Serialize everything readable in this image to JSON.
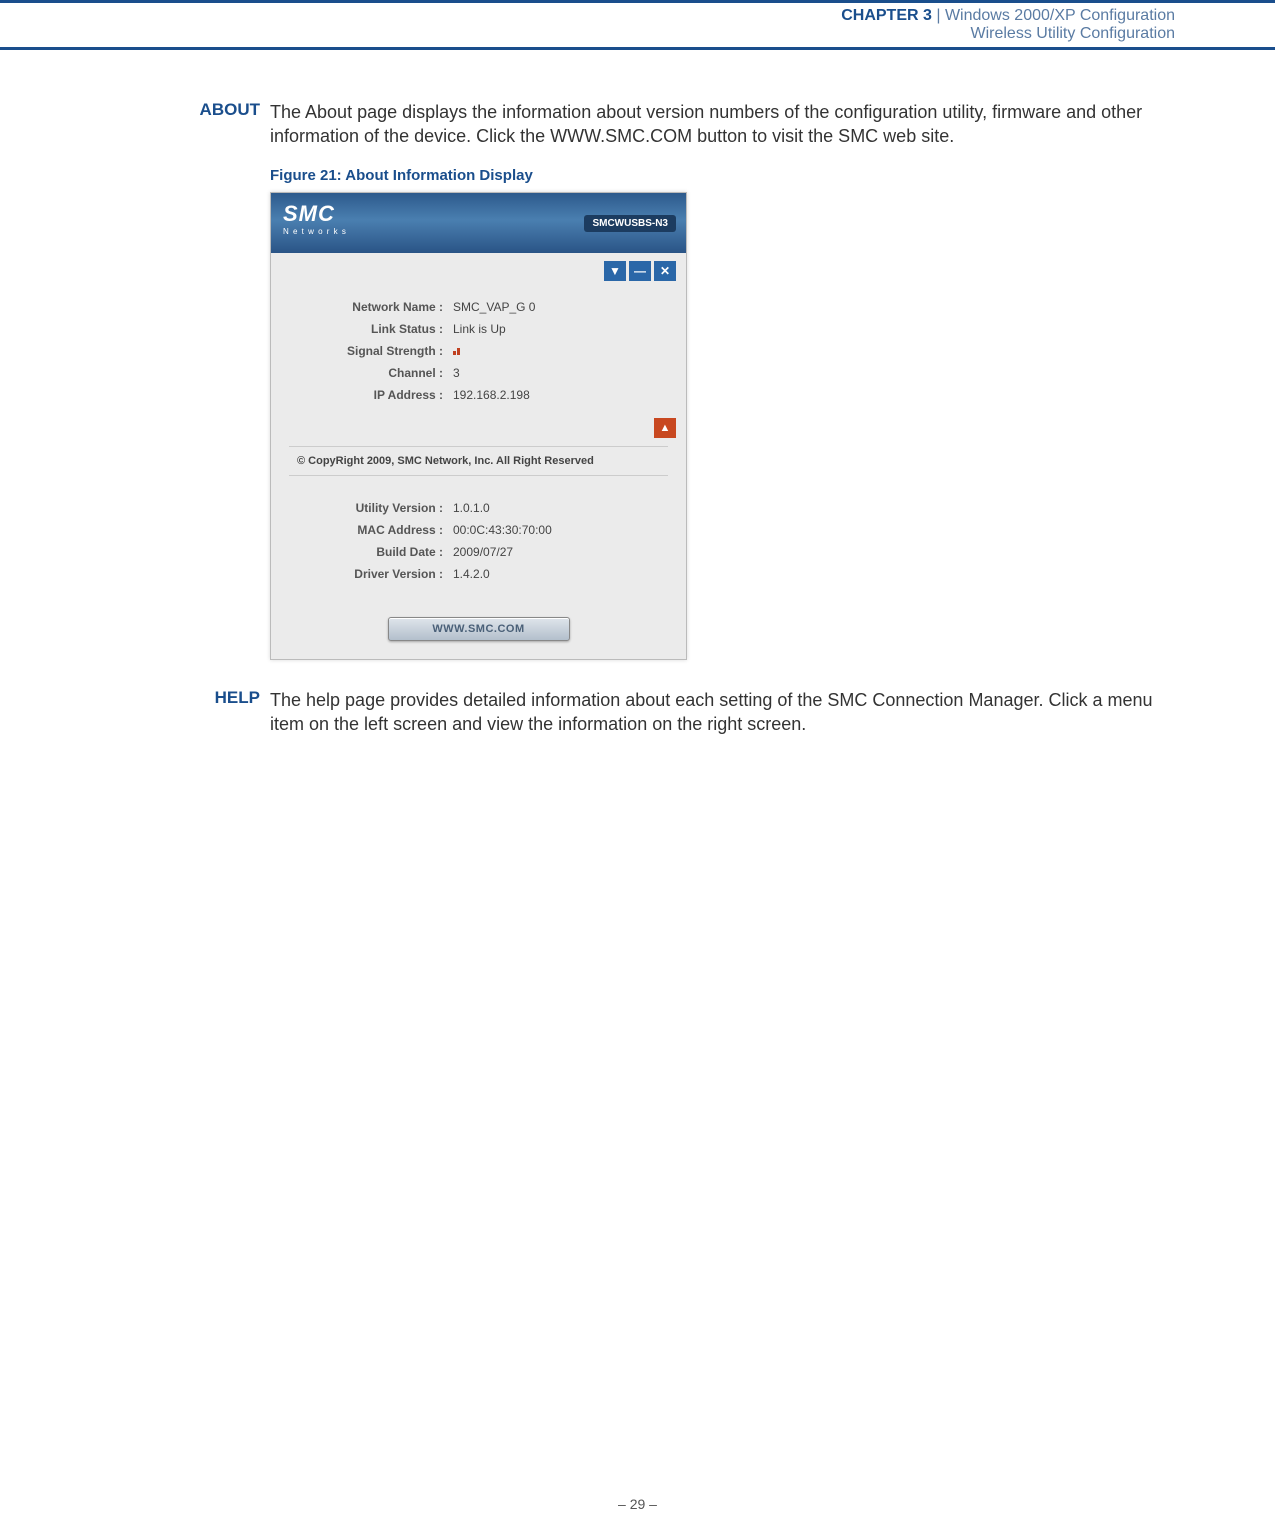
{
  "header": {
    "chapter_label": "CHAPTER 3",
    "separator": "  |  ",
    "chapter_title": "Windows 2000/XP Configuration",
    "section_title": "Wireless Utility Configuration"
  },
  "about_section": {
    "label": "ABOUT",
    "text": "The About page displays the information about version numbers of the configuration utility, firmware and other information of the device. Click the WWW.SMC.COM button to visit the SMC web site."
  },
  "figure_caption": "Figure 21:  About Information Display",
  "app": {
    "logo_main": "SMC",
    "logo_sub": "N e t w o r k s",
    "model": "SMCWUSBS-N3",
    "window_controls": {
      "down": "▼",
      "min": "—",
      "close": "✕"
    },
    "top_fields": [
      {
        "label": "Network Name :",
        "value": "SMC_VAP_G 0"
      },
      {
        "label": "Link Status :",
        "value": "Link is Up"
      },
      {
        "label": "Signal Strength :",
        "value": ""
      },
      {
        "label": "Channel :",
        "value": "3"
      },
      {
        "label": "IP Address :",
        "value": "192.168.2.198"
      }
    ],
    "collapse_glyph": "▲",
    "copyright": "© CopyRight 2009, SMC Network, Inc. All Right Reserved",
    "bottom_fields": [
      {
        "label": "Utility Version :",
        "value": "1.0.1.0"
      },
      {
        "label": "MAC Address :",
        "value": "00:0C:43:30:70:00"
      },
      {
        "label": "Build Date :",
        "value": "2009/07/27"
      },
      {
        "label": "Driver Version :",
        "value": "1.4.2.0"
      }
    ],
    "button_label": "WWW.SMC.COM"
  },
  "help_section": {
    "label": "HELP",
    "text": "The help page provides detailed information about each setting of the SMC Connection Manager. Click a menu item on the left screen and view the information on the right screen."
  },
  "page_number": "–  29  –"
}
